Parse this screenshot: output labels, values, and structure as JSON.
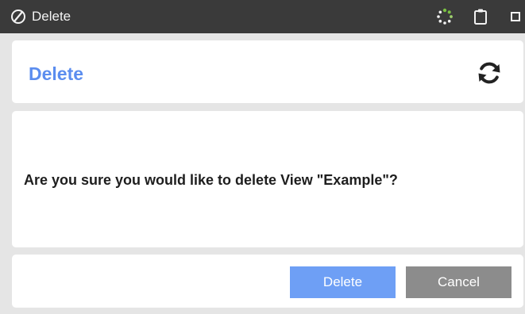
{
  "window": {
    "title": "Delete",
    "icons": [
      "app-logo-icon",
      "loading-spinner-icon",
      "clipboard-icon",
      "maximize-icon"
    ]
  },
  "dialog": {
    "title": "Delete",
    "refresh_icon": "refresh-icon",
    "message": "Are you sure you would like to delete View \"Example\"?",
    "buttons": {
      "delete_label": "Delete",
      "cancel_label": "Cancel"
    }
  },
  "colors": {
    "titlebar": "#3a3a3a",
    "accent_title": "#5b8def",
    "delete_button": "#6e9ff5",
    "cancel_button": "#8c8c8c",
    "spinner": "#7bc143"
  }
}
